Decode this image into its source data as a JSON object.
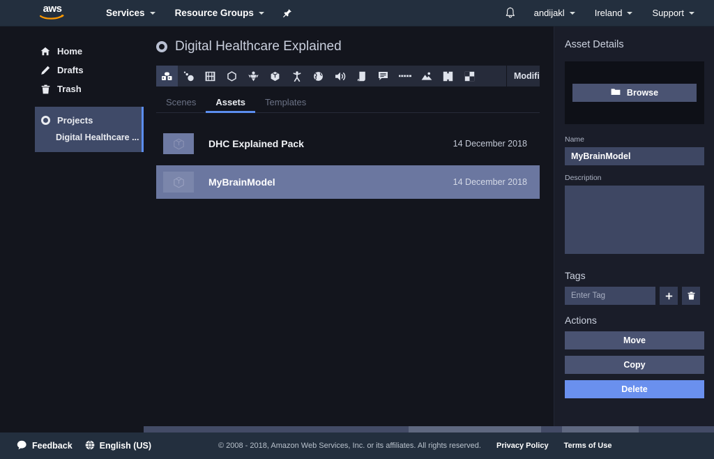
{
  "topnav": {
    "logo_text": "aws",
    "left_items": [
      {
        "label": "Services",
        "caret": true
      },
      {
        "label": "Resource Groups",
        "caret": true
      }
    ],
    "pin_icon": "pin-icon",
    "bell_icon": "bell-icon",
    "right_items": [
      {
        "label": "andijakl",
        "caret": true
      },
      {
        "label": "Ireland",
        "caret": true
      },
      {
        "label": "Support",
        "caret": true
      }
    ]
  },
  "sidebar": {
    "items": [
      {
        "label": "Home",
        "icon": "home-icon"
      },
      {
        "label": "Drafts",
        "icon": "pencil-icon"
      },
      {
        "label": "Trash",
        "icon": "trash-icon"
      }
    ],
    "group": {
      "label": "Projects",
      "icon": "ring-icon",
      "children": [
        {
          "label": "Digital Healthcare ..."
        }
      ]
    }
  },
  "main": {
    "title": "Digital Healthcare Explained",
    "title_icon": "ring-icon",
    "toolbar_icons": [
      "all-assets-icon",
      "particle-icon",
      "film-icon",
      "hexagon-icon",
      "avatar-icon",
      "model-3d-icon",
      "animation-icon",
      "environment-icon",
      "audio-icon",
      "script-icon",
      "dialog-icon",
      "json-icon",
      "image-icon",
      "puzzle-icon",
      "texture-icon"
    ],
    "sort_label": "Modified (",
    "tabs": [
      {
        "label": "Scenes",
        "active": false
      },
      {
        "label": "Assets",
        "active": true
      },
      {
        "label": "Templates",
        "active": false
      }
    ],
    "assets": [
      {
        "name": "DHC Explained Pack",
        "date": "14 December 2018",
        "selected": false,
        "icon": "package-icon"
      },
      {
        "name": "MyBrainModel",
        "date": "14 December 2018",
        "selected": true,
        "icon": "package-icon"
      }
    ]
  },
  "details": {
    "title": "Asset Details",
    "browse_label": "Browse",
    "browse_icon": "folder-icon",
    "name_label": "Name",
    "name_value": "MyBrainModel",
    "description_label": "Description",
    "description_value": "",
    "tags_label": "Tags",
    "tag_placeholder": "Enter Tag",
    "tag_value": "",
    "tag_add_icon": "plus-icon",
    "tag_delete_icon": "trash-icon",
    "actions_label": "Actions",
    "actions": [
      {
        "label": "Move",
        "primary": false
      },
      {
        "label": "Copy",
        "primary": false
      },
      {
        "label": "Delete",
        "primary": true
      }
    ]
  },
  "footer": {
    "feedback_label": "Feedback",
    "feedback_icon": "speech-bubble-icon",
    "language_label": "English (US)",
    "language_icon": "globe-icon",
    "copyright": "© 2008 - 2018, Amazon Web Services, Inc. or its affiliates. All rights reserved.",
    "links": [
      "Privacy Policy",
      "Terms of Use"
    ]
  },
  "colors": {
    "aws_navy": "#232f3e",
    "aws_orange": "#ff9900",
    "app_bg": "#13151d",
    "panel_bg": "#1a1d29",
    "accent_blue": "#5b8dee",
    "selection": "#6b77a0",
    "field_bg": "#3e4763",
    "button_bg": "#4a5372",
    "primary_button": "#6a90ee"
  }
}
